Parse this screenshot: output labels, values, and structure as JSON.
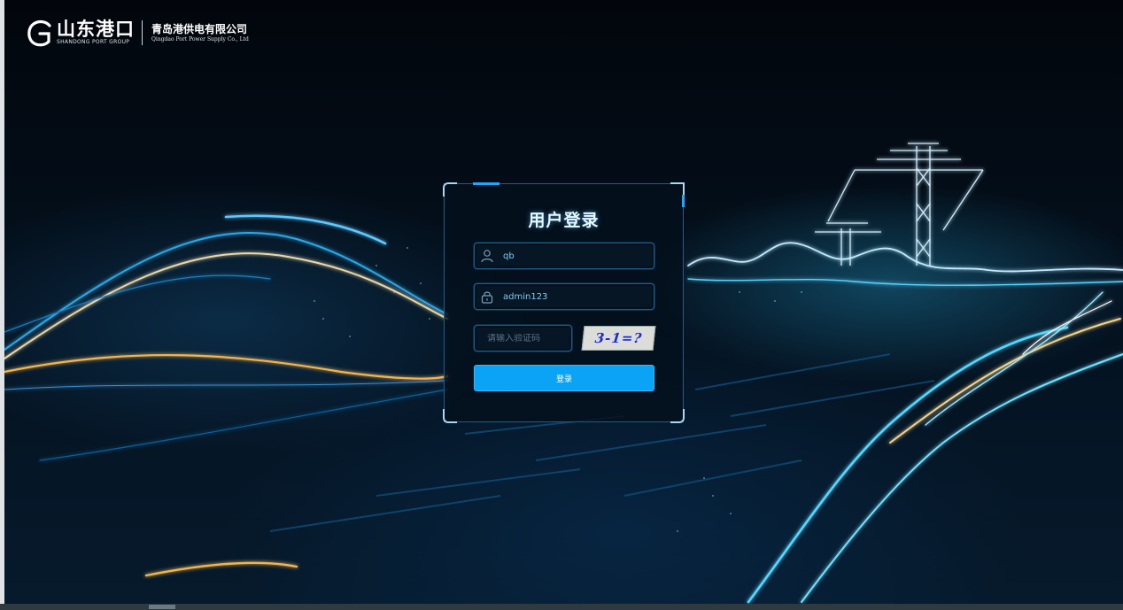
{
  "brand": {
    "name_cn": "山东港口",
    "name_en": "SHANDONG PORT GROUP",
    "company_cn": "青岛港供电有限公司",
    "company_en": "Qingdao Port Power Supply Co., Ltd",
    "logo_icon": "shandong-port-logo-icon"
  },
  "login": {
    "title": "用户登录",
    "username": {
      "value": "qb",
      "icon": "user-icon"
    },
    "password": {
      "value": "admin123",
      "icon": "lock-icon"
    },
    "captcha": {
      "placeholder": "请输入验证码",
      "image_text": "3-1=?"
    },
    "submit_label": "登录"
  },
  "colors": {
    "accent": "#0aa3f5",
    "background": "#020810",
    "card_border": "#1d5c86",
    "field_text": "#7fc8f0"
  }
}
